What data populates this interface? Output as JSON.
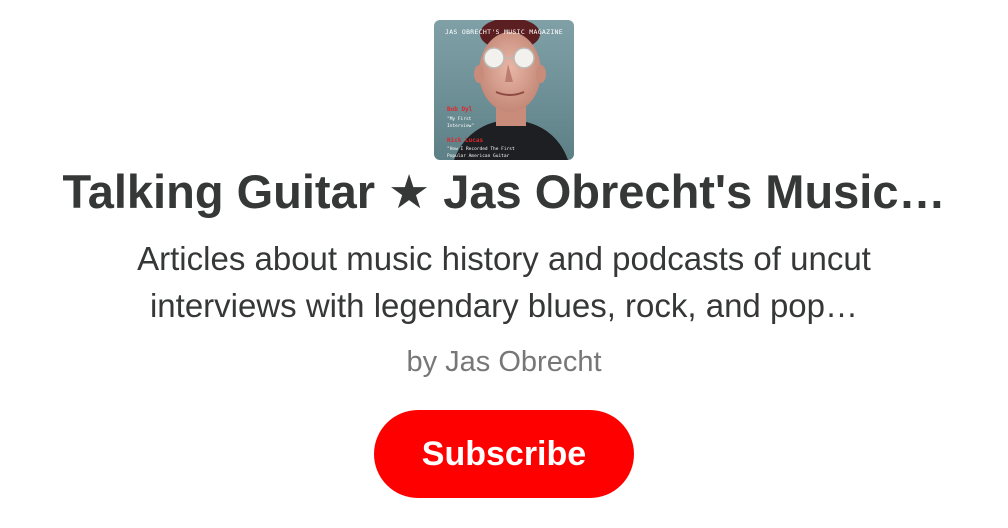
{
  "publication": {
    "cover": {
      "masthead": "JAS OBRECHT'S MUSIC MAGAZINE",
      "lines": [
        {
          "text": "Bob Dyl",
          "style": "red"
        },
        {
          "text": "\"My First",
          "style": "white"
        },
        {
          "text": "Interview\"",
          "style": "white"
        },
        {
          "text": "Nick Lucas",
          "style": "red"
        },
        {
          "text": "\"How I Recorded The First",
          "style": "white"
        },
        {
          "text": "Popular American Guitar",
          "style": "white"
        }
      ]
    },
    "title": "Talking Guitar ★ Jas Obrecht's Music…",
    "description_lines": [
      "Articles about music history and podcasts of uncut",
      "interviews with legendary blues, rock, and pop…"
    ],
    "byline": "by Jas Obrecht"
  },
  "actions": {
    "subscribe_label": "Subscribe"
  },
  "colors": {
    "accent": "#ff0000",
    "title_text": "#363737",
    "byline_text": "#777777"
  }
}
